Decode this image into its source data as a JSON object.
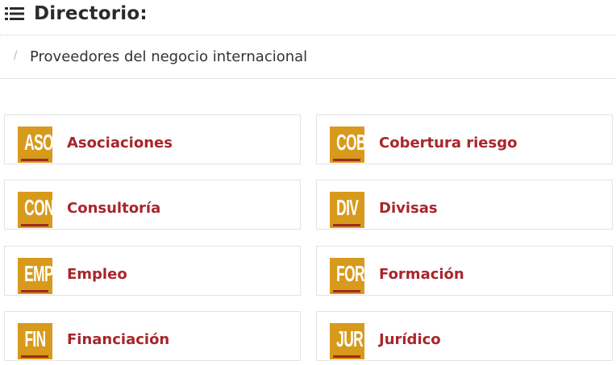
{
  "header": {
    "title": "Directorio:",
    "icon": "list-icon"
  },
  "breadcrumb": {
    "separator": "/",
    "current": "Proveedores del negocio internacional"
  },
  "colors": {
    "badge_bg": "#d79a1c",
    "badge_bar": "#9e2a1f",
    "link": "#a8262b"
  },
  "categories": [
    {
      "code": "ASO",
      "label": "Asociaciones"
    },
    {
      "code": "COB",
      "label": "Cobertura riesgo"
    },
    {
      "code": "CON",
      "label": "Consultoría"
    },
    {
      "code": "DIV",
      "label": "Divisas"
    },
    {
      "code": "EMP",
      "label": "Empleo"
    },
    {
      "code": "FOR",
      "label": "Formación"
    },
    {
      "code": "FIN",
      "label": "Financiación"
    },
    {
      "code": "JUR",
      "label": "Jurídico"
    }
  ]
}
